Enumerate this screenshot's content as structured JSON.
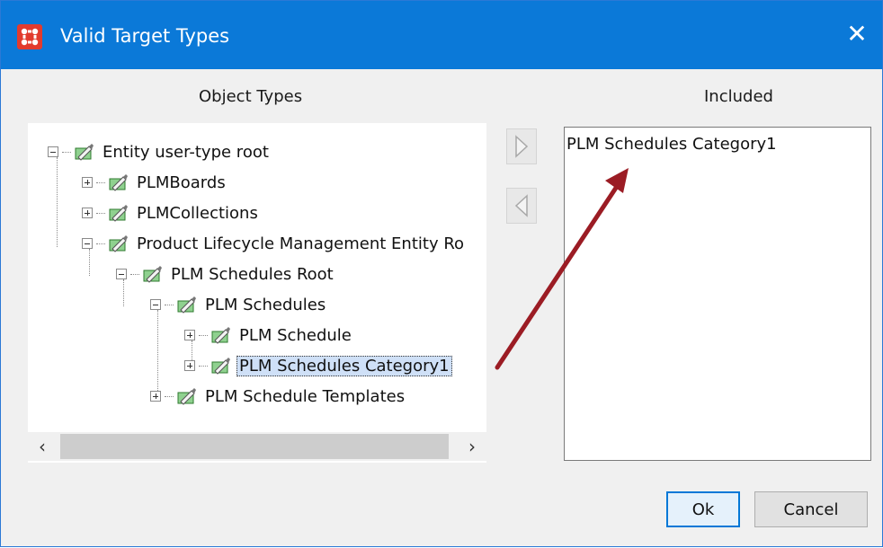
{
  "window": {
    "title": "Valid Target Types",
    "close_glyph": "✕"
  },
  "left_panel": {
    "label": "Object Types"
  },
  "right_panel": {
    "label": "Included",
    "items": [
      "PLM Schedules Category1"
    ]
  },
  "tree": {
    "nodes": [
      {
        "label": "Entity user-type root",
        "expander": "minus"
      },
      {
        "label": "PLMBoards",
        "expander": "plus"
      },
      {
        "label": "PLMCollections",
        "expander": "plus"
      },
      {
        "label": "Product Lifecycle Management Entity Ro",
        "expander": "minus"
      },
      {
        "label": "PLM Schedules Root",
        "expander": "minus"
      },
      {
        "label": "PLM Schedules",
        "expander": "minus"
      },
      {
        "label": "PLM Schedule",
        "expander": "plus"
      },
      {
        "label": "PLM Schedules Category1",
        "expander": "plus",
        "selected": true
      },
      {
        "label": "PLM Schedule Templates",
        "expander": "plus"
      }
    ]
  },
  "scrollbar": {
    "left_glyph": "‹",
    "right_glyph": "›"
  },
  "buttons": {
    "ok": "Ok",
    "cancel": "Cancel"
  },
  "colors": {
    "titlebar": "#0b79d8",
    "arrow": "#9b1c24",
    "selection": "#cfe0f7",
    "icon_green": "#3aa63a"
  }
}
